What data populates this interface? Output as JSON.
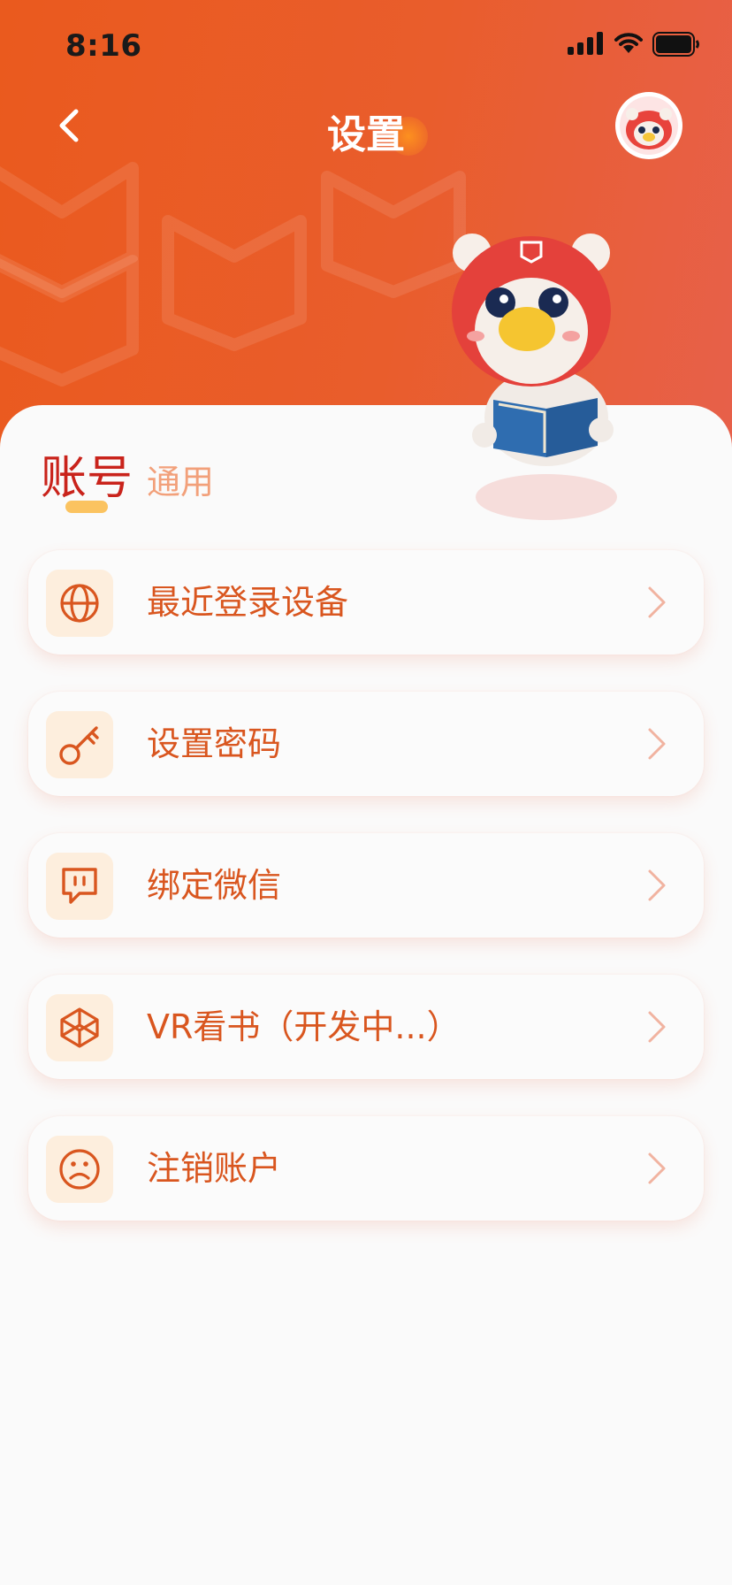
{
  "status_bar": {
    "time": "8:16",
    "icons": [
      "signal-icon",
      "wifi-icon",
      "battery-icon"
    ]
  },
  "header": {
    "title": "设置",
    "back_icon": "chevron-left-icon",
    "avatar": "mascot-avatar"
  },
  "tabs": [
    {
      "label": "账号",
      "active": true
    },
    {
      "label": "通用",
      "active": false
    }
  ],
  "menu": [
    {
      "label": "最近登录设备",
      "icon": "globe-icon"
    },
    {
      "label": "设置密码",
      "icon": "key-icon"
    },
    {
      "label": "绑定微信",
      "icon": "chat-bubble-icon"
    },
    {
      "label": "VR看书（开发中...）",
      "icon": "cube-icon"
    },
    {
      "label": "注销账户",
      "icon": "sad-face-icon"
    }
  ],
  "colors": {
    "header_gradient_start": "#ea5a1e",
    "header_gradient_end": "#e7604a",
    "accent": "#d9561f",
    "tab_active": "#c9231b",
    "tab_inactive": "#f2a07a",
    "icon_bg": "#fdeedd"
  }
}
